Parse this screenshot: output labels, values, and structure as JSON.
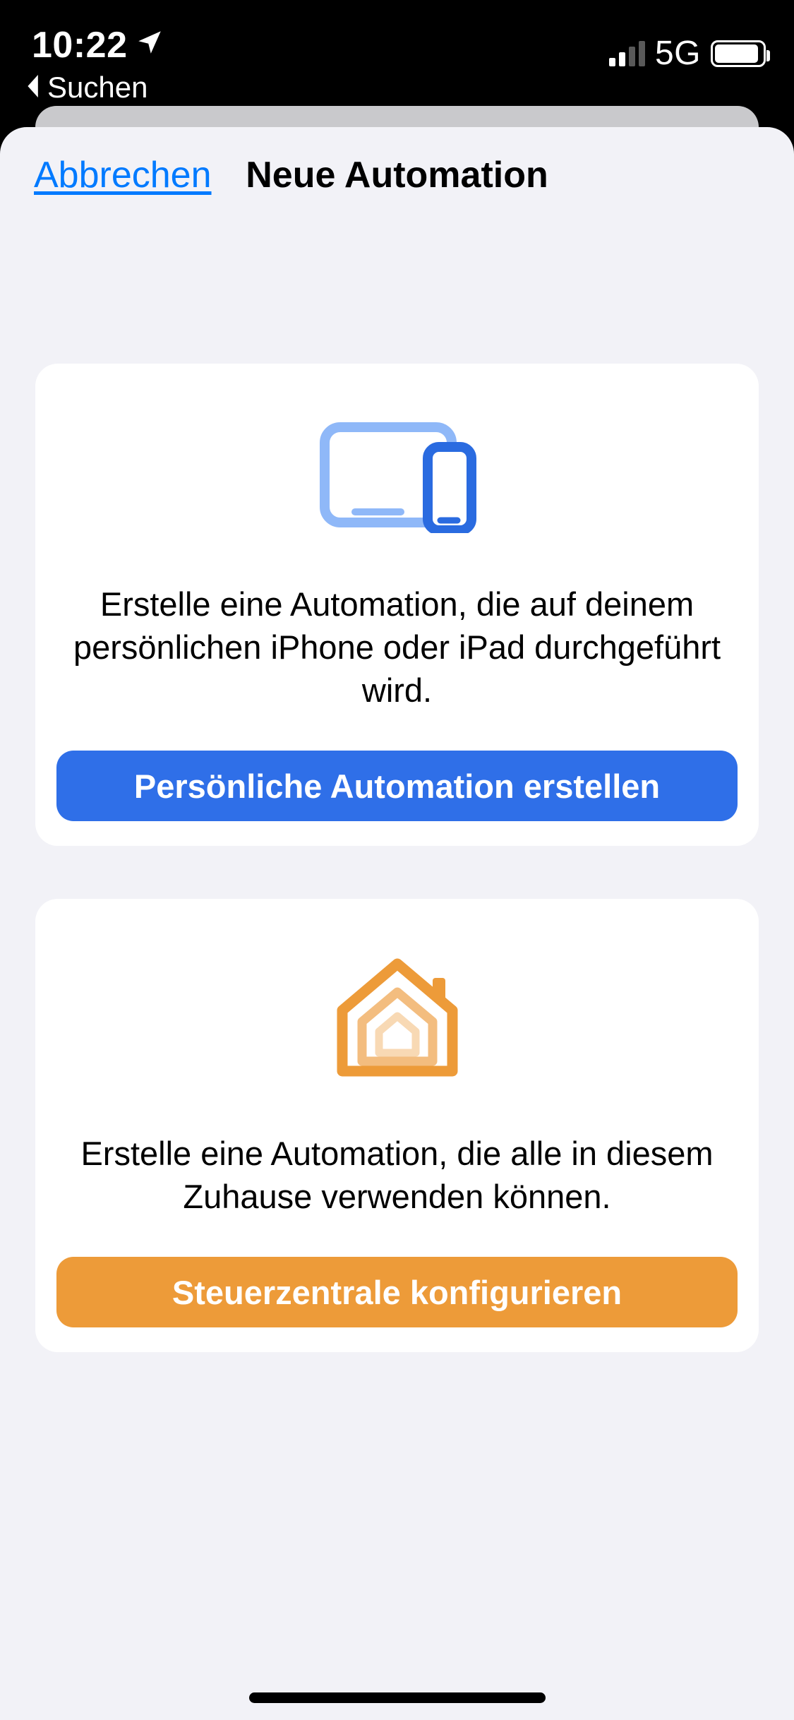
{
  "status_bar": {
    "time": "10:22",
    "back_app": "Suchen",
    "network_label": "5G"
  },
  "nav": {
    "cancel": "Abbrechen",
    "title": "Neue Automation"
  },
  "cards": {
    "personal": {
      "description": "Erstelle eine Automation, die auf deinem persönlichen iPhone oder iPad durchgeführt wird.",
      "button": "Persönliche Automation erstellen"
    },
    "home": {
      "description": "Erstelle eine Automation, die alle in diesem Zuhause verwenden können.",
      "button": "Steuerzentrale konfigurieren"
    }
  },
  "colors": {
    "accent_blue": "#2f6fe8",
    "accent_orange": "#ed9b39",
    "sheet_bg": "#f2f2f7"
  }
}
